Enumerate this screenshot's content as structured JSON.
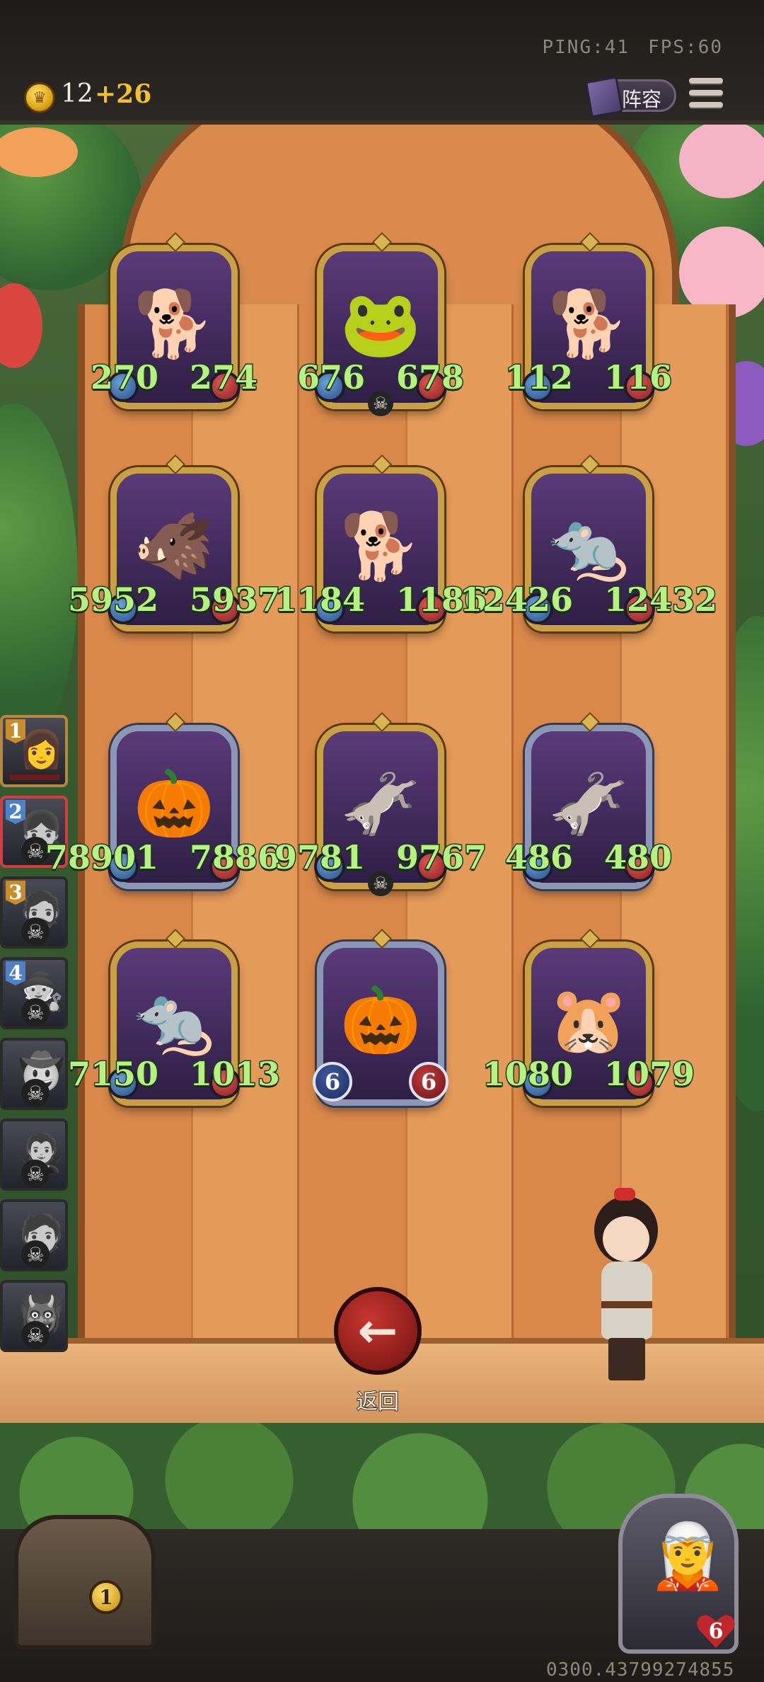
{
  "header": {
    "ping_label": "PING:41",
    "fps_label": "FPS:60",
    "gold": "12",
    "gold_income": "+26",
    "lineup_label": "阵容"
  },
  "board": {
    "cards": [
      {
        "creature": "dog",
        "attack": "270",
        "health": "274",
        "frame": "gold",
        "skull": false
      },
      {
        "creature": "frog-with-apple",
        "attack": "676",
        "health": "678",
        "frame": "gold",
        "skull": true
      },
      {
        "creature": "dog",
        "attack": "112",
        "health": "116",
        "frame": "gold",
        "skull": false
      },
      {
        "creature": "boar",
        "attack": "5952",
        "health": "5937",
        "frame": "gold",
        "skull": false
      },
      {
        "creature": "dog",
        "attack": "1184",
        "health": "1186",
        "frame": "gold",
        "skull": false
      },
      {
        "creature": "masked-rat",
        "attack": "12426",
        "health": "12432",
        "frame": "gold",
        "skull": false
      },
      {
        "creature": "pumpkin-scarecrow",
        "attack": "78901",
        "health": "7886",
        "frame": "silver",
        "skull": false
      },
      {
        "creature": "donkey-bard",
        "attack": "9781",
        "health": "9767",
        "frame": "gold",
        "skull": true
      },
      {
        "creature": "donkey-bard",
        "attack": "486",
        "health": "480",
        "frame": "silver",
        "skull": false
      },
      {
        "creature": "masked-rat",
        "attack": "7150",
        "health": "1013",
        "frame": "gold",
        "skull": false
      },
      {
        "creature": "pumpkin-scarecrow",
        "attack": "6",
        "health": "6",
        "frame": "silver",
        "skull": false
      },
      {
        "creature": "hamster",
        "attack": "1080",
        "health": "1079",
        "frame": "gold",
        "skull": false
      }
    ]
  },
  "opponents": [
    {
      "rank": "1",
      "eliminated": false,
      "badge_color": "gold"
    },
    {
      "rank": "2",
      "eliminated": true,
      "badge_color": "blue"
    },
    {
      "rank": "3",
      "eliminated": true,
      "badge_color": "gold"
    },
    {
      "rank": "4",
      "eliminated": true,
      "badge_color": "blue"
    },
    {
      "rank": "",
      "eliminated": true,
      "badge_color": "gray"
    },
    {
      "rank": "",
      "eliminated": true,
      "badge_color": "gray"
    },
    {
      "rank": "",
      "eliminated": true,
      "badge_color": "gray"
    },
    {
      "rank": "",
      "eliminated": true,
      "badge_color": "gray"
    }
  ],
  "actions": {
    "return_label": "返回"
  },
  "footer": {
    "chest_count": "1",
    "hero_health": "6",
    "version": "0300.43799274855"
  }
}
